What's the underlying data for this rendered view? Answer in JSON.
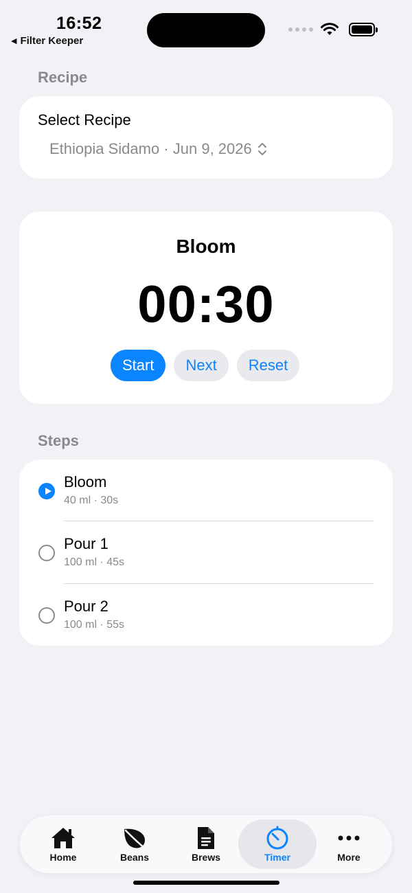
{
  "status": {
    "time": "16:52",
    "back_label": "Filter Keeper"
  },
  "recipe": {
    "section_title": "Recipe",
    "select_label": "Select Recipe",
    "selected_value": "Ethiopia Sidamo · Jun 9, 2026"
  },
  "timer": {
    "current_step": "Bloom",
    "time_remaining": "00:30",
    "start_label": "Start",
    "next_label": "Next",
    "reset_label": "Reset"
  },
  "steps": {
    "section_title": "Steps",
    "items": [
      {
        "title": "Bloom",
        "detail": "40 ml · 30s",
        "active": true
      },
      {
        "title": "Pour 1",
        "detail": "100 ml · 45s",
        "active": false
      },
      {
        "title": "Pour 2",
        "detail": "100 ml · 55s",
        "active": false
      }
    ]
  },
  "tabs": [
    {
      "label": "Home",
      "icon": "house-icon"
    },
    {
      "label": "Beans",
      "icon": "leaf-icon"
    },
    {
      "label": "Brews",
      "icon": "document-icon"
    },
    {
      "label": "Timer",
      "icon": "timer-icon",
      "active": true
    },
    {
      "label": "More",
      "icon": "ellipsis-icon"
    }
  ],
  "colors": {
    "accent": "#0a84ff",
    "background": "#f1f1f6",
    "secondary_text": "#8a8a8e"
  }
}
